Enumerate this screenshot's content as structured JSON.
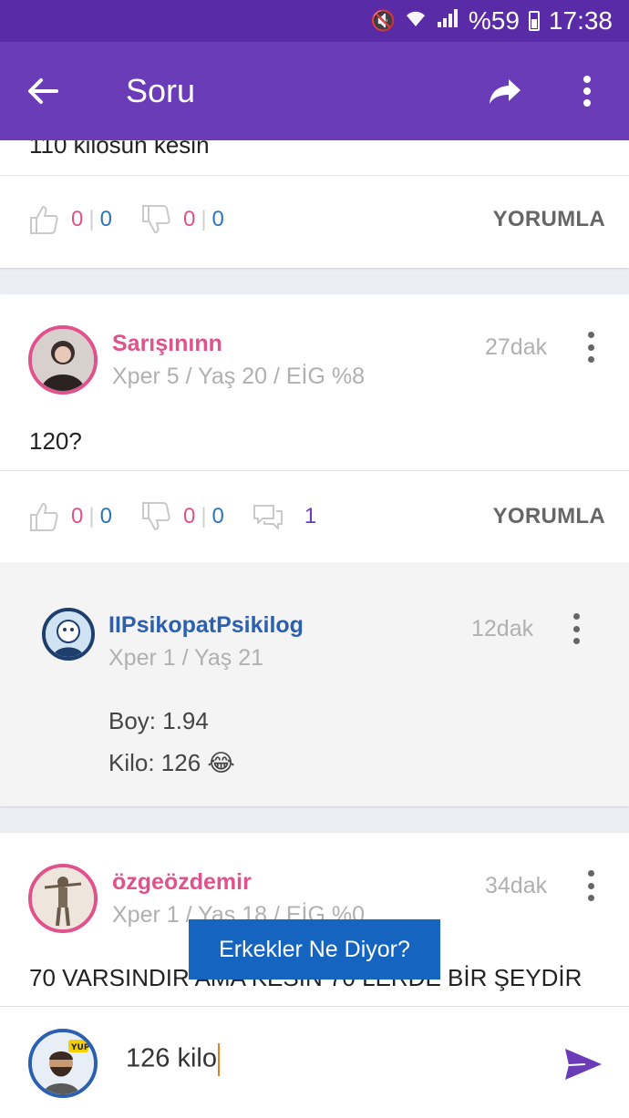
{
  "status_bar": {
    "signal_text": "%59",
    "time": "17:38"
  },
  "app_bar": {
    "title": "Soru"
  },
  "answers": [
    {
      "truncated_text": "110 kilosun kesin",
      "likes_pink": "0",
      "likes_blue": "0",
      "dislikes_pink": "0",
      "dislikes_blue": "0",
      "comment_label": "YORUMLA"
    },
    {
      "username": "Sarışınınn",
      "meta": "Xper 5 / Yaş 20 / EİG %8",
      "time": "27dak",
      "text": "120?",
      "likes_pink": "0",
      "likes_blue": "0",
      "dislikes_pink": "0",
      "dislikes_blue": "0",
      "comment_count": "1",
      "comment_label": "YORUMLA",
      "reply": {
        "username": "IIPsikopatPsikilog",
        "meta": "Xper 1 / Yaş 21",
        "time": "12dak",
        "line1": "Boy: 1.94",
        "line2": "Kilo: 126 😂"
      }
    },
    {
      "username": "özgeözdemir",
      "meta": "Xper 1 / Yaş 18 / EİG %0",
      "time": "34dak",
      "text": "70 VARSINDIR AMA KESİN 70 LERDE BİR ŞEYDİR"
    }
  ],
  "toast": {
    "label": "Erkekler Ne Diyor?"
  },
  "comment_input": {
    "value": "126 kilo"
  },
  "colors": {
    "status_bar": "#5a2ba6",
    "app_bar": "#6a3cb8",
    "pink": "#e0528b",
    "blue": "#2f73b8",
    "toast": "#1565c0"
  }
}
